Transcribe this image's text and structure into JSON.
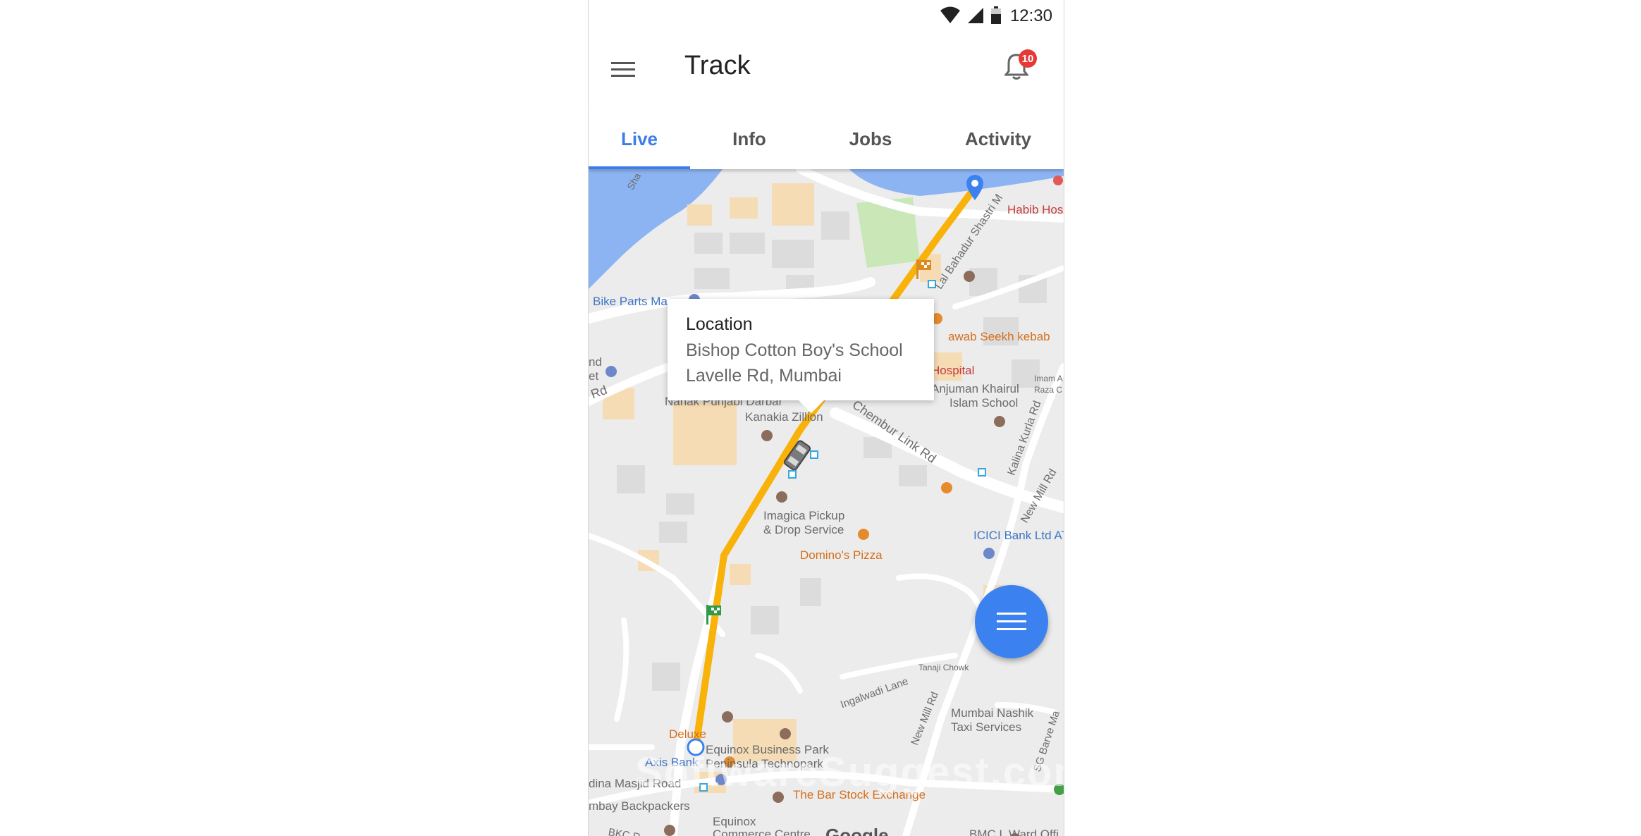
{
  "status_bar": {
    "time": "12:30"
  },
  "app_bar": {
    "title": "Track",
    "notification_count": "10"
  },
  "tabs": [
    {
      "label": "Live",
      "active": true
    },
    {
      "label": "Info",
      "active": false
    },
    {
      "label": "Jobs",
      "active": false
    },
    {
      "label": "Activity",
      "active": false
    }
  ],
  "popup": {
    "title": "Location",
    "line1": "Bishop Cotton Boy's School",
    "line2": "Lavelle Rd, Mumbai"
  },
  "map_labels": {
    "bike_parts": "Bike Parts Ma",
    "habib": "Habib Hos",
    "lal_bahadur": "Lal Bahadur Shastri M",
    "nawab": "awab Seekh kebab",
    "hospital": "Hospital",
    "anjuman1": "Anjuman Khairul",
    "anjuman2": "Islam School",
    "imam": "Imam A",
    "raza": "Raza C",
    "nanak": "Nanak Punjabi Darbar",
    "kanakia": "Kanakia Zillion",
    "chembur": "Chembur Link Rd",
    "kalina": "Kalina Kurla Rd",
    "new_mill_1": "New Mill Rd",
    "imagica1": "Imagica Pickup",
    "imagica2": "& Drop Service",
    "dominos": "Domino's Pizza",
    "icici": "ICICI Bank Ltd AT",
    "tanaji": "Tanaji Chowk",
    "ingalwadi": "Ingalwadi Lane",
    "new_mill_2": "New Mill Rd",
    "nashik1": "Mumbai Nashik",
    "nashik2": "Taxi Services",
    "deluxe": "Deluxe",
    "equinox_park": "Equinox Business Park",
    "peninsula": "Peninsula Technopark",
    "axis": "Axis Bank",
    "masjid": "dina Masjid Road",
    "backpackers": "mbay Backpackers",
    "bar_stock": "The Bar Stock Exchange",
    "equinox_cc1": "Equinox",
    "equinox_cc2": "Commerce Centre",
    "bmc": "BMC L Ward Offi",
    "bkc": "BKC R",
    "sg_barve": "SG Barve Ma",
    "left_nd": "nd",
    "left_et": "et",
    "left_rd": "Rd",
    "sha": "Sha"
  },
  "watermark": "SoftwareSuggest.com",
  "google_logo": "Google",
  "colors": {
    "accent": "#3c7de8",
    "route": "#f9b20a",
    "water": "#8db4f2",
    "badge": "#e53935",
    "fab": "#3b82f0"
  },
  "icons": [
    "wifi-icon",
    "signal-icon",
    "battery-icon",
    "menu-icon",
    "bell-icon",
    "vehicle-icon",
    "start-flag-icon",
    "end-flag-icon",
    "destination-pin-icon",
    "origin-circle-icon"
  ]
}
